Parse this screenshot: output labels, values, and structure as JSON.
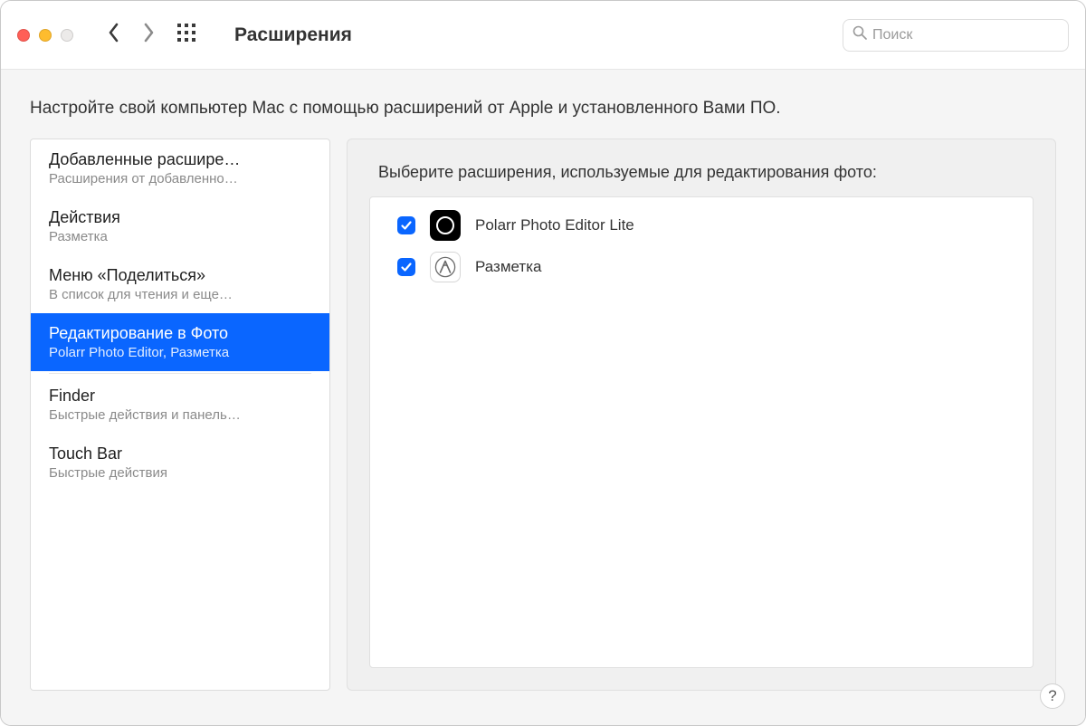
{
  "window": {
    "title": "Расширения",
    "search_placeholder": "Поиск"
  },
  "intro_text": "Настройте свой компьютер Mac с помощью расширений от Apple и установленного Вами ПО.",
  "sidebar": {
    "items": [
      {
        "title": "Добавленные расшире…",
        "subtitle": "Расширения от добавленно…",
        "selected": false
      },
      {
        "title": "Действия",
        "subtitle": "Разметка",
        "selected": false
      },
      {
        "title": "Меню «Поделиться»",
        "subtitle": "В список для чтения и еще…",
        "selected": false
      },
      {
        "title": "Редактирование в Фото",
        "subtitle": "Polarr Photo Editor, Разметка",
        "selected": true
      },
      {
        "title": "Finder",
        "subtitle": "Быстрые действия и панель…",
        "selected": false
      },
      {
        "title": "Touch Bar",
        "subtitle": "Быстрые действия",
        "selected": false
      }
    ]
  },
  "detail": {
    "heading": "Выберите расширения, используемые для редактирования фото:",
    "items": [
      {
        "label": "Polarr Photo Editor Lite",
        "checked": true,
        "icon": "polarr"
      },
      {
        "label": "Разметка",
        "checked": true,
        "icon": "markup"
      }
    ]
  },
  "help_label": "?"
}
